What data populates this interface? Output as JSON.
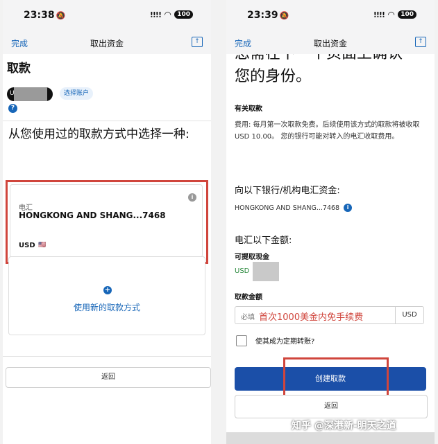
{
  "left": {
    "status": {
      "time": "23:38",
      "signal": "!!!!",
      "battery": "100"
    },
    "nav": {
      "done": "完成",
      "title": "取出资金"
    },
    "title": "取款",
    "account_initial": "U",
    "select_account": "选择账户",
    "help": "?",
    "question": "从您使用过的取款方式中选择一种:",
    "method": {
      "label": "电汇",
      "bank": "HONGKONG AND SHANG...7468",
      "currency": "USD",
      "info": "i"
    },
    "new_method": {
      "plus": "+",
      "label": "使用新的取款方式"
    },
    "back": "返回"
  },
  "right": {
    "status": {
      "time": "23:39",
      "signal": "!!!!",
      "battery": "100"
    },
    "nav": {
      "done": "完成",
      "title": "取出资金"
    },
    "cut_text": "您需在下一个页面上确认",
    "identity": "您的身份。",
    "about_h": "有关取款",
    "fee_text": "费用: 每月第一次取款免费。后续使用该方式的取款将被收取USD 10.00。 您的银行可能对转入的电汇收取费用。",
    "wire_h": "向以下银行/机构电汇资金:",
    "bank": "HONGKONG AND SHANG...7468",
    "bank_info": "i",
    "amount_h": "电汇以下金额:",
    "available_label": "可提取现金",
    "available_currency": "USD",
    "amount_label": "取款金额",
    "amount_placeholder": "必填",
    "amount_note": "首次1000美金内免手续费",
    "amount_currency": "USD",
    "recurring_label": "使其成为定期转账?",
    "create": "创建取款",
    "back": "返回"
  },
  "watermark": "知乎 @深港新-明天之道",
  "colors": {
    "accent": "#1766b8",
    "primary_button": "#1b4fa8",
    "highlight": "#d0453c",
    "money": "#2b8a3e"
  }
}
